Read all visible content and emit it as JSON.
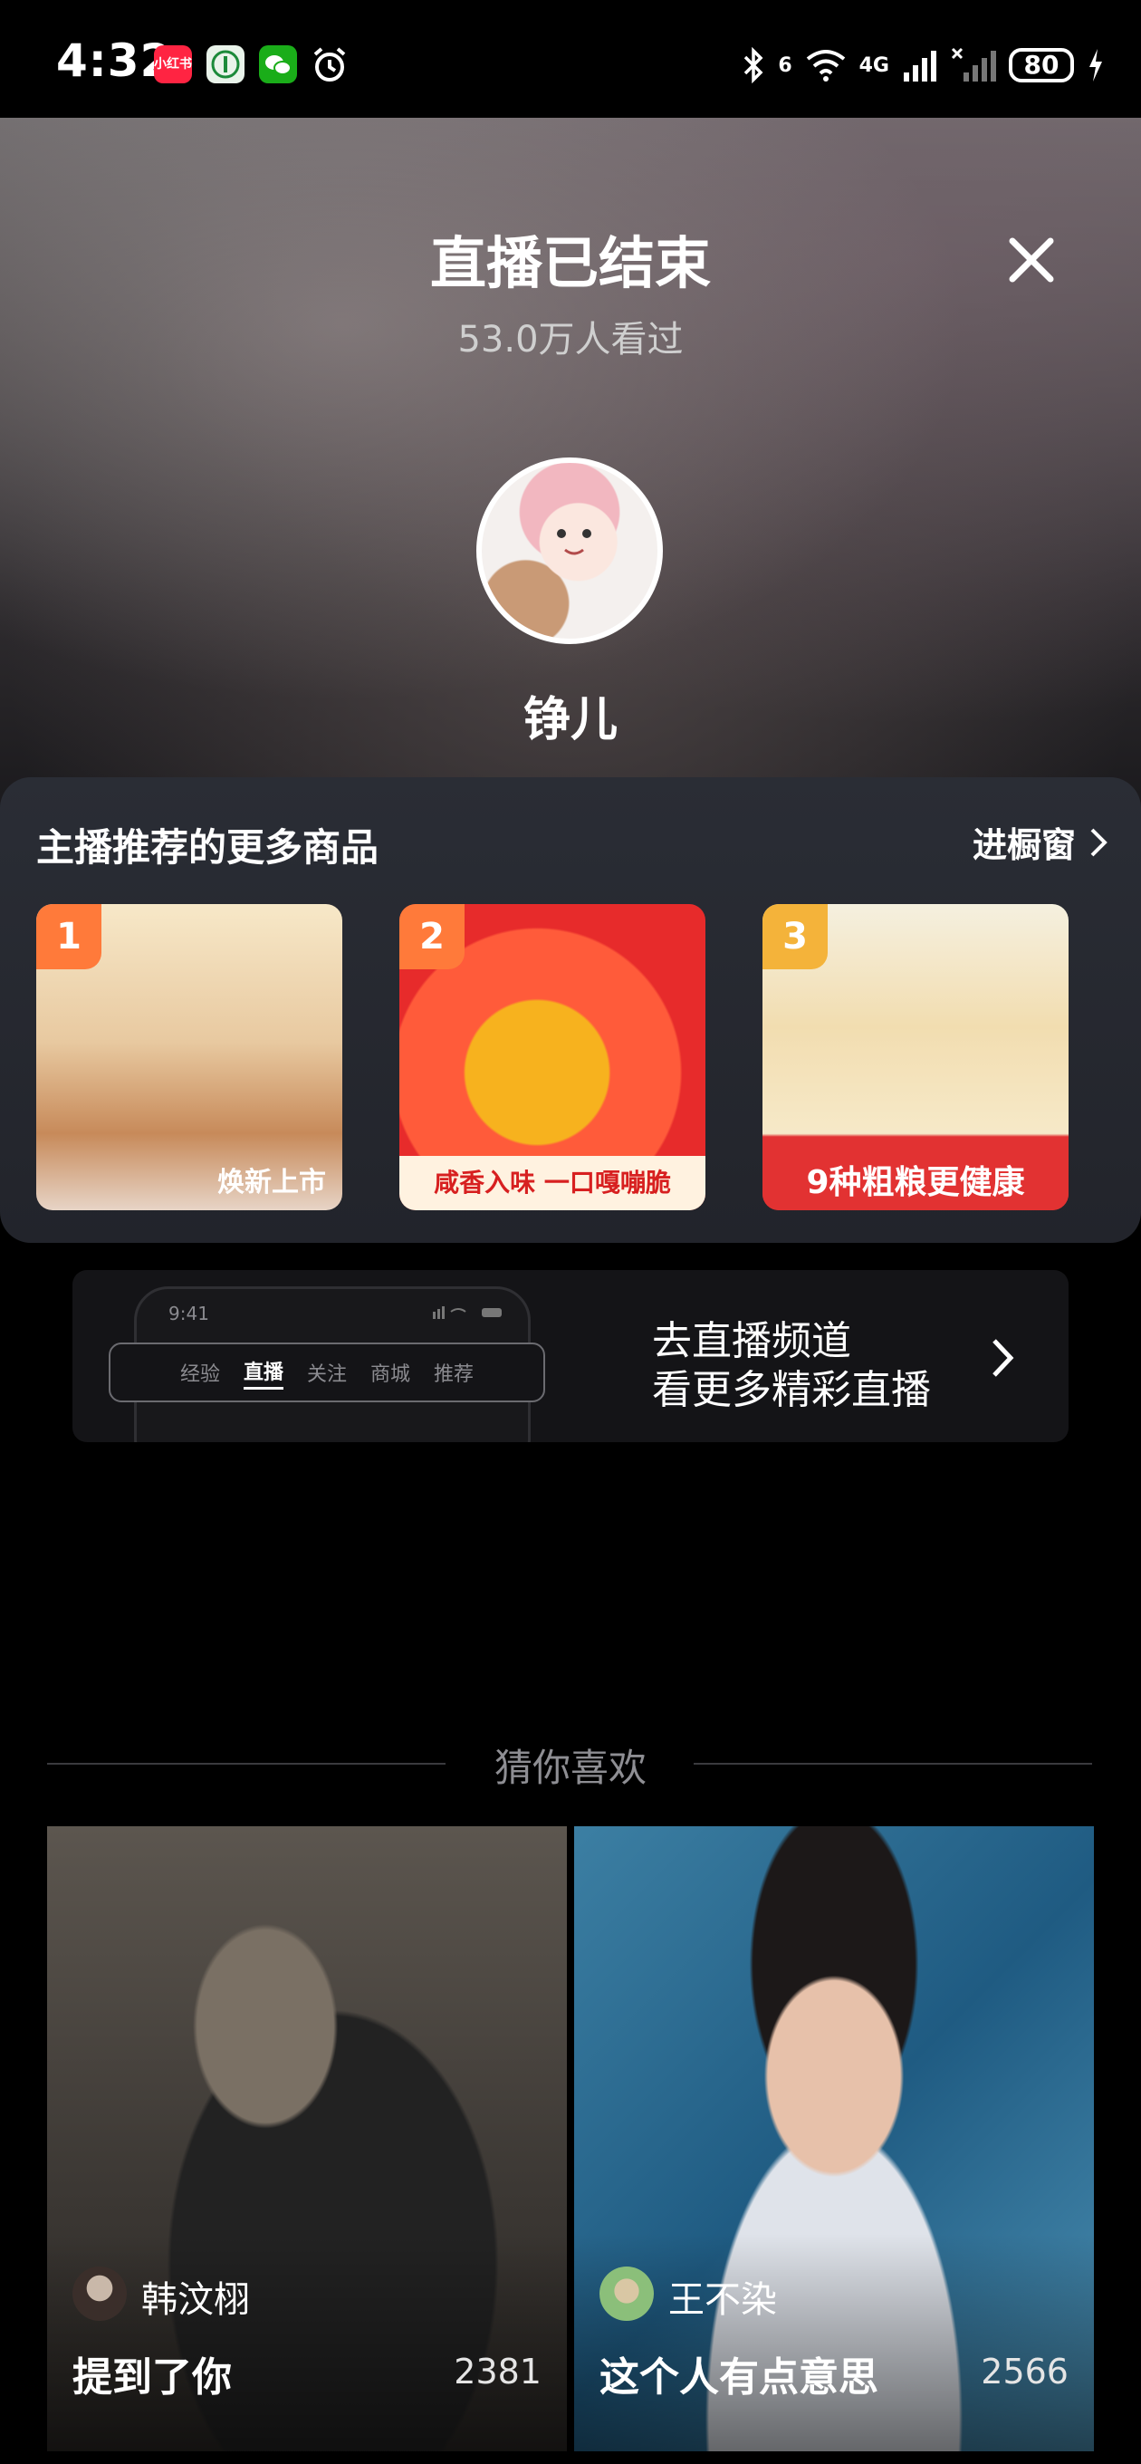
{
  "status_bar": {
    "time": "4:32",
    "apps": [
      {
        "name": "xiaohongshu-icon",
        "label": "小红书"
      },
      {
        "name": "green-app-icon",
        "label": ""
      },
      {
        "name": "wechat-icon",
        "label": ""
      },
      {
        "name": "alarm-icon",
        "label": ""
      }
    ],
    "network_left": "6",
    "network_right": "4G",
    "battery": "80"
  },
  "header": {
    "title": "直播已结束",
    "viewers": "53.0万人看过",
    "close_icon": "close-icon",
    "streamer_name": "铮儿"
  },
  "products": {
    "title": "主播推荐的更多商品",
    "showcase_label": "进橱窗",
    "items": [
      {
        "rank": "1",
        "caption": "焕新上市"
      },
      {
        "rank": "2",
        "caption": "咸香入味 一口嘎嘣脆"
      },
      {
        "rank": "3",
        "caption": "9种粗粮更健康"
      }
    ]
  },
  "live_banner": {
    "mock_time": "9:41",
    "mock_tabs": [
      "经验",
      "直播",
      "关注",
      "商城",
      "推荐"
    ],
    "mock_active_tab": "直播",
    "line1": "去直播频道",
    "line2": "看更多精彩直播"
  },
  "guess": {
    "title": "猜你喜欢",
    "cards": [
      {
        "name": "韩汶栩",
        "title": "提到了你",
        "count": "2381"
      },
      {
        "name": "王不染",
        "title": "这个人有点意思",
        "count": "2566"
      }
    ]
  },
  "colors": {
    "background": "#000000",
    "panel": "#272a31",
    "rank_badge": "#ff7a3a"
  }
}
